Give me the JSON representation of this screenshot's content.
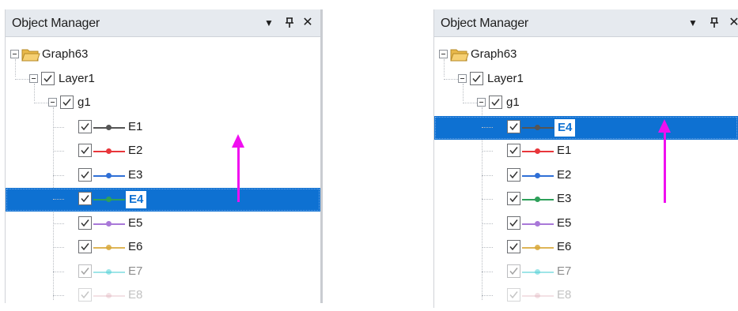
{
  "left_panel": {
    "title": "Object Manager",
    "controls": {
      "dropdown": "▼",
      "pin": "⊓",
      "close": "✕"
    },
    "tree": {
      "root": "Graph63",
      "layer": "Layer1",
      "group": "g1",
      "plots": [
        {
          "label": "E1",
          "color": "#555555",
          "selected": false
        },
        {
          "label": "E2",
          "color": "#e8363b",
          "selected": false
        },
        {
          "label": "E3",
          "color": "#2f6fd6",
          "selected": false
        },
        {
          "label": "E4",
          "color": "#2ea05a",
          "selected": true
        },
        {
          "label": "E5",
          "color": "#a978d8",
          "selected": false
        },
        {
          "label": "E6",
          "color": "#d8a83a",
          "selected": false
        },
        {
          "label": "E7",
          "color": "#4fd0d6",
          "selected": false
        },
        {
          "label": "E8",
          "color": "#d69ba8",
          "selected": false
        }
      ]
    }
  },
  "right_panel": {
    "title": "Object Manager",
    "controls": {
      "dropdown": "▼",
      "pin": "⊓",
      "close": "✕"
    },
    "tree": {
      "root": "Graph63",
      "layer": "Layer1",
      "group": "g1",
      "plots": [
        {
          "label": "E4",
          "color": "#555555",
          "selected": true
        },
        {
          "label": "E1",
          "color": "#e8363b",
          "selected": false
        },
        {
          "label": "E2",
          "color": "#2f6fd6",
          "selected": false
        },
        {
          "label": "E3",
          "color": "#2ea05a",
          "selected": false
        },
        {
          "label": "E5",
          "color": "#a978d8",
          "selected": false
        },
        {
          "label": "E6",
          "color": "#d8a83a",
          "selected": false
        },
        {
          "label": "E7",
          "color": "#4fd0d6",
          "selected": false
        },
        {
          "label": "E8",
          "color": "#d69ba8",
          "selected": false
        }
      ]
    }
  },
  "colors": {
    "selection": "#0e71d2",
    "arrow": "#f00ff0",
    "titlebar": "#e6eaef"
  }
}
